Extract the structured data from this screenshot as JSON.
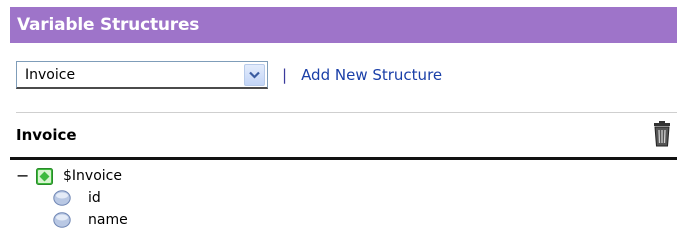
{
  "header": {
    "title": "Variable Structures"
  },
  "selector": {
    "selected": "Invoice",
    "separator": "|",
    "add_link": "Add New Structure"
  },
  "section": {
    "title": "Invoice"
  },
  "tree": {
    "collapse_glyph": "−",
    "root": "$Invoice",
    "fields": [
      "id",
      "name"
    ]
  },
  "colors": {
    "header_bg": "#9e74c9",
    "link": "#1a3fa8",
    "struct_icon": "#3dba3d",
    "leaf_icon": "#8aa4cf"
  },
  "icons": {
    "dropdown": "chevron-down-icon",
    "delete": "trash-icon",
    "structure": "structure-icon",
    "field": "field-icon"
  }
}
